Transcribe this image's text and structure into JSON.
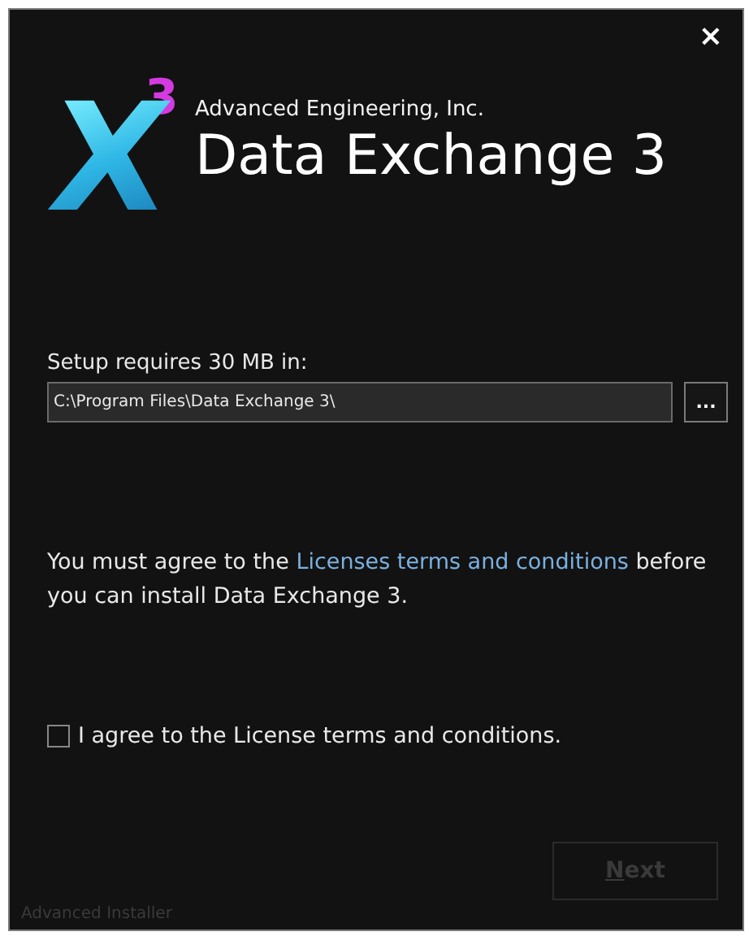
{
  "window": {
    "close": "×"
  },
  "logo": {
    "letter": "X",
    "superscript": "3"
  },
  "header": {
    "company": "Advanced Engineering, Inc.",
    "product": "Data Exchange 3"
  },
  "location": {
    "label": "Setup requires 30 MB in:",
    "value": "C:\\Program Files\\Data Exchange 3\\",
    "browse": "..."
  },
  "notice": {
    "before": "You must agree to the ",
    "link": "Licenses terms and conditions",
    "after": " before you can install Data Exchange 3."
  },
  "agree": {
    "label": "I agree to the License terms and conditions.",
    "checked": false
  },
  "next": {
    "label": "Next",
    "mnemonic_shown": true,
    "disabled": true
  },
  "footer": "Advanced Installer"
}
